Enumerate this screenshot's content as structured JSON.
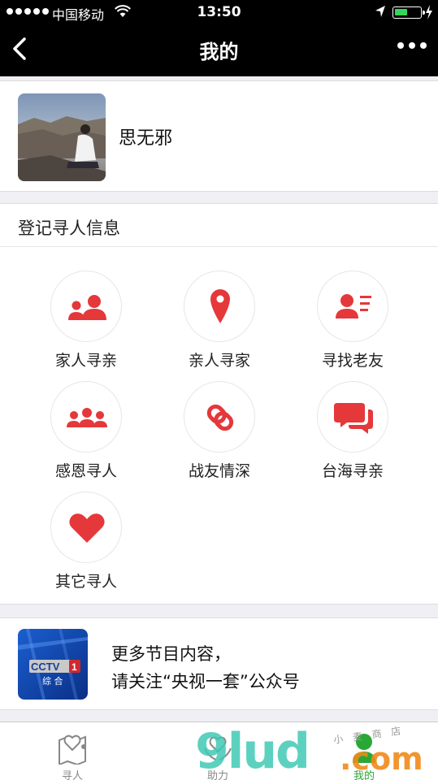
{
  "status_bar": {
    "carrier": "中国移动",
    "time": "13:50"
  },
  "nav": {
    "title": "我的"
  },
  "profile": {
    "name": "思无邪"
  },
  "register": {
    "title": "登记寻人信息",
    "items": [
      {
        "label": "家人寻亲",
        "icon": "family-people-icon"
      },
      {
        "label": "亲人寻家",
        "icon": "location-pin-icon"
      },
      {
        "label": "寻找老友",
        "icon": "contact-card-icon"
      },
      {
        "label": "感恩寻人",
        "icon": "group-people-icon"
      },
      {
        "label": "战友情深",
        "icon": "chain-link-icon"
      },
      {
        "label": "台海寻亲",
        "icon": "chat-bubbles-icon"
      },
      {
        "label": "其它寻人",
        "icon": "heart-icon"
      }
    ],
    "icon_color": "#e5383b"
  },
  "promo": {
    "logo_text": "CCTV 1 综合",
    "line1": "更多节目内容，",
    "line2": "请关注“央视一套”公众号"
  },
  "tabbar": {
    "tabs": [
      {
        "label": "寻人",
        "icon": "map-heart-icon",
        "active": false
      },
      {
        "label": "助力",
        "icon": "hands-heart-icon",
        "active": false
      },
      {
        "label": "我的",
        "icon": "user-icon",
        "active": true
      }
    ],
    "active_color": "#2aa835"
  },
  "watermark": {
    "main": "9lud",
    "suffix": ".com",
    "small": "小 麦 商 店"
  }
}
